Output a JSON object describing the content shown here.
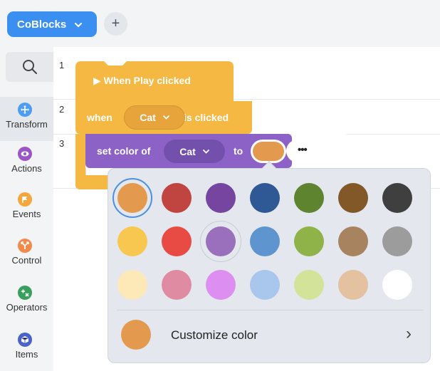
{
  "toolbar": {
    "project_name": "CoBlocks",
    "project_chevron": "⌄",
    "add_label": "+"
  },
  "sidebar": {
    "search_icon": "search-icon",
    "categories": [
      {
        "label": "Transform",
        "icon": "move-icon",
        "color": "#4f9df2",
        "selected": true
      },
      {
        "label": "Actions",
        "icon": "eye-icon",
        "color": "#9b55c6",
        "selected": false
      },
      {
        "label": "Events",
        "icon": "flag-icon",
        "color": "#f5a73c",
        "selected": false
      },
      {
        "label": "Control",
        "icon": "branch-icon",
        "color": "#f38a4a",
        "selected": false
      },
      {
        "label": "Operators",
        "icon": "math-icon",
        "color": "#3a9f5d",
        "selected": false
      },
      {
        "label": "Items",
        "icon": "box-icon",
        "color": "#4a62c9",
        "selected": false
      }
    ]
  },
  "script": {
    "lines": [
      "1",
      "2",
      "3"
    ],
    "blocks": {
      "play": {
        "label": "▶ When Play clicked"
      },
      "when": {
        "prefix": "when",
        "target": "Cat",
        "suffix": "is clicked"
      },
      "setcolor": {
        "prefix": "set color of",
        "target": "Cat",
        "mid": "to",
        "more": "•••"
      }
    },
    "dropdown_chevron": "⌄"
  },
  "color_picker": {
    "selected_color": "#e39a4e",
    "colors": [
      [
        "#e39a4e",
        "#c0443f",
        "#7645a0",
        "#2e5995",
        "#5f8430",
        "#835829",
        "#3f3f3f"
      ],
      [
        "#f7c750",
        "#e84b43",
        "#9a6fbc",
        "#5f95cf",
        "#8fb348",
        "#a8835f",
        "#9c9c9c"
      ],
      [
        "#fde8b8",
        "#df8ca3",
        "#dd8ef1",
        "#a9c6ec",
        "#d3e49a",
        "#e3c1a1",
        "#ffffff"
      ]
    ],
    "hovered": {
      "row": 1,
      "col": 2
    },
    "customize_label": "Customize color",
    "customize_color": "#e39a4e",
    "customize_chevron": "›"
  }
}
